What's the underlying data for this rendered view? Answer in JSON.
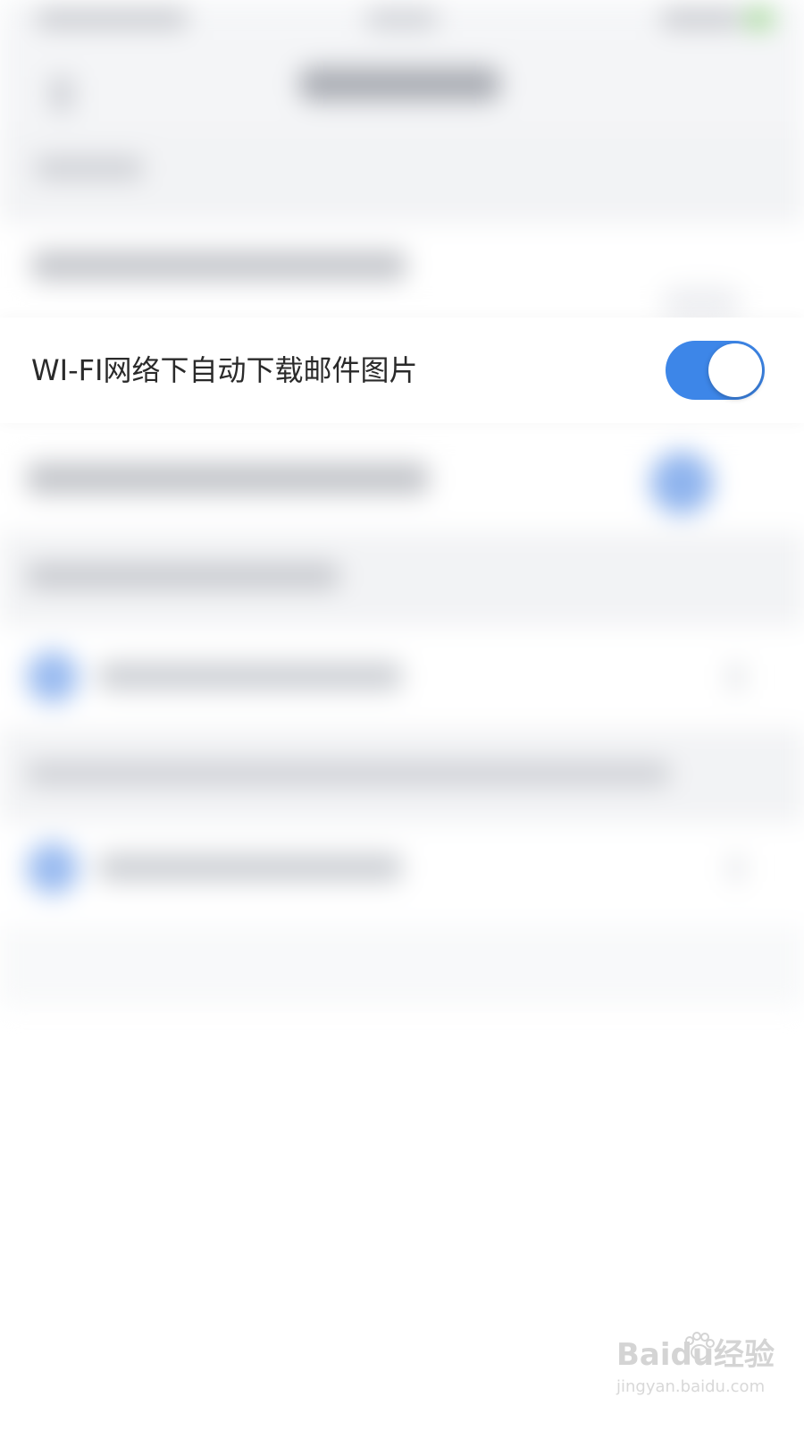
{
  "settings_row": {
    "label": "WI-FI网络下自动下载邮件图片",
    "toggle_on": true
  },
  "colors": {
    "accent": "#3d86e8",
    "background": "#ffffff",
    "section_background": "#f2f3f5",
    "text": "#2a2a2a"
  },
  "watermark": {
    "brand": "Baidu经验",
    "url": "jingyan.baidu.com"
  }
}
